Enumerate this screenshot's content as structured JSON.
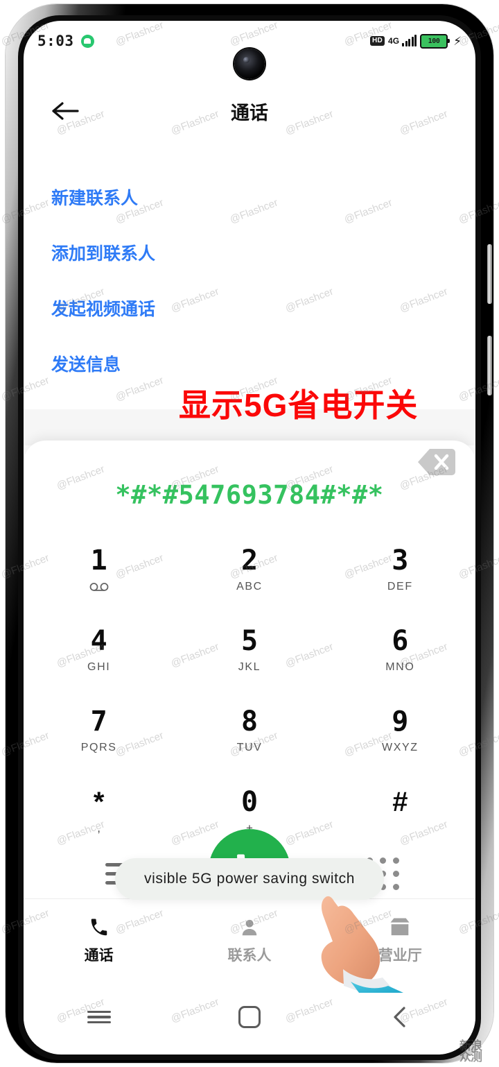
{
  "status_bar": {
    "time": "5:03",
    "android_icon": "android-robot-icon",
    "hd_label": "HD",
    "network_type": "4G",
    "signal_icon": "signal-bars-icon",
    "battery_level": "100",
    "charging_icon": "charging-bolt-icon"
  },
  "header": {
    "back_icon": "back-arrow-icon",
    "title": "通话"
  },
  "action_links": [
    {
      "label": "新建联系人"
    },
    {
      "label": "添加到联系人"
    },
    {
      "label": "发起视频通话"
    },
    {
      "label": "发送信息"
    }
  ],
  "annotation": {
    "text": "显示5G省电开关",
    "color": "#fb0808"
  },
  "dialer": {
    "number": "*#*#547693784#*#*",
    "number_color": "#35c25f",
    "backspace_icon": "backspace-icon",
    "keys": [
      {
        "digit": "1",
        "sub": "",
        "sub_icon": "voicemail-icon"
      },
      {
        "digit": "2",
        "sub": "ABC",
        "sub_icon": ""
      },
      {
        "digit": "3",
        "sub": "DEF",
        "sub_icon": ""
      },
      {
        "digit": "4",
        "sub": "GHI",
        "sub_icon": ""
      },
      {
        "digit": "5",
        "sub": "JKL",
        "sub_icon": ""
      },
      {
        "digit": "6",
        "sub": "MNO",
        "sub_icon": ""
      },
      {
        "digit": "7",
        "sub": "PQRS",
        "sub_icon": ""
      },
      {
        "digit": "8",
        "sub": "TUV",
        "sub_icon": ""
      },
      {
        "digit": "9",
        "sub": "WXYZ",
        "sub_icon": ""
      },
      {
        "digit": "*",
        "sub": ",",
        "sub_icon": ""
      },
      {
        "digit": "0",
        "sub": "+",
        "sub_icon": ""
      },
      {
        "digit": "#",
        "sub": "",
        "sub_icon": ""
      }
    ],
    "call_button_icon": "phone-call-icon",
    "call_button_color": "#22b14c",
    "menu_icon": "list-menu-icon",
    "keypad_toggle_icon": "dial-grid-icon"
  },
  "toast": {
    "message": "visible 5G power saving switch"
  },
  "pointer": {
    "icon": "pointing-hand-icon"
  },
  "tabs": [
    {
      "label": "通话",
      "icon": "phone-icon",
      "active": true
    },
    {
      "label": "联系人",
      "icon": "person-icon",
      "active": false
    },
    {
      "label": "营业厅",
      "icon": "store-icon",
      "active": false
    }
  ],
  "nav_bar": {
    "recents_icon": "recents-menu-icon",
    "home_icon": "home-square-icon",
    "back_icon": "back-chevron-icon"
  },
  "watermarks": {
    "text": "@Flashcer",
    "corner_text": "新浪众测"
  }
}
